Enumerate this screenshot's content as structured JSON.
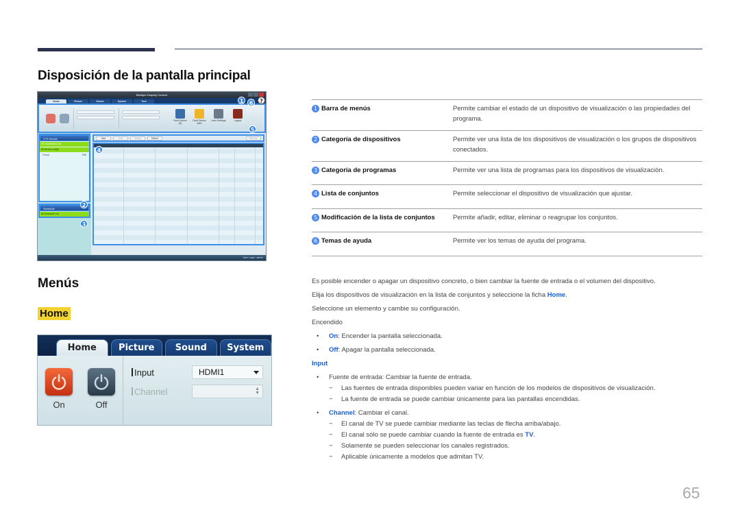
{
  "page": {
    "section_title": "Disposición de la pantalla principal",
    "menus_title": "Menús",
    "home_tag": "Home",
    "page_number": "65"
  },
  "app_screenshot": {
    "title": "Multiple Display Control",
    "tabs": [
      "Home",
      "Picture",
      "Sound",
      "System",
      "Tool"
    ],
    "ribbon": {
      "power": [
        "On",
        "Off"
      ],
      "fields": [
        "Input",
        "Channel",
        "Volume"
      ],
      "mute_label": "Mute",
      "icons": [
        {
          "label": "Fault Device (D)",
          "icon": "fault-device-icon"
        },
        {
          "label": "Fault Device Alert",
          "icon": "alert-icon"
        },
        {
          "label": "User Settings",
          "icon": "user-settings-icon"
        },
        {
          "label": "Logout",
          "icon": "logout-icon"
        }
      ]
    },
    "left_panel": {
      "device_header": "LFD Device",
      "device_rows": [
        "All Connection List",
        "All Device List(0)"
      ],
      "group_label": "Group",
      "group_edit": "Edit",
      "schedule_header": "Schedule",
      "schedule_rows": [
        "All Schedule List"
      ]
    },
    "toolbar": [
      "Add",
      "Edit",
      "Delete",
      "Detect",
      "Refresh"
    ],
    "grid_columns": [
      "Settings",
      "Connection Status",
      "MAC Address",
      "Connection Type",
      "Port",
      "SET ID Ran..",
      "Group"
    ],
    "status_bar": "User Login : admin",
    "badges": [
      "1",
      "2",
      "3",
      "4",
      "5",
      "6"
    ],
    "help_icon": "?"
  },
  "legend": [
    {
      "num": "1",
      "name": "Barra de menús",
      "desc": "Permite cambiar el estado de un dispositivo de visualización o las propiedades del programa."
    },
    {
      "num": "2",
      "name": "Categoría de dispositivos",
      "desc": "Permite ver una lista de los dispositivos de visualización o los grupos de dispositivos conectados."
    },
    {
      "num": "3",
      "name": "Categoría de programas",
      "desc": "Permite ver una lista de programas para los dispositivos de visualización."
    },
    {
      "num": "4",
      "name": "Lista de conjuntos",
      "desc": "Permite seleccionar el dispositivo de visualización que ajustar."
    },
    {
      "num": "5",
      "name": "Modificación de la lista de conjuntos",
      "desc": "Permite añadir, editar, eliminar o reagrupar los conjuntos."
    },
    {
      "num": "6",
      "name": "Temas de ayuda",
      "desc": "Permite ver los temas de ayuda del programa."
    }
  ],
  "home_menu": {
    "tabs": [
      "Home",
      "Picture",
      "Sound",
      "System"
    ],
    "on_label": "On",
    "off_label": "Off",
    "input_label": "Input",
    "input_value": "HDMI1",
    "channel_label": "Channel",
    "channel_value": ""
  },
  "body": {
    "p1": "Es posible encender o apagar un dispositivo concreto, o bien cambiar la fuente de entrada o el volumen del dispositivo.",
    "p2_pre": "Elija los dispositivos de visualización en la lista de conjuntos y seleccione la ficha ",
    "p2_link": "Home",
    "p2_post": ".",
    "p3": "Seleccione un elemento y cambie su configuración.",
    "p4": "Encendido",
    "on_term": "On",
    "on_text": ": Encender la pantalla seleccionada.",
    "off_term": "Off",
    "off_text": ": Apagar la pantalla seleccionada.",
    "input_heading": "Input",
    "input_bullet": "Fuente de entrada: Cambiar la fuente de entrada.",
    "input_notes": [
      "Las fuentes de entrada disponibles pueden variar en función de los modelos de dispositivos de visualización.",
      "La fuente de entrada se puede cambiar únicamente para las pantallas encendidas."
    ],
    "channel_term": "Channel",
    "channel_text": ": Cambiar el canal.",
    "channel_note1": "El canal de TV se puede cambiar mediante las teclas de flecha arriba/abajo.",
    "channel_note2_pre": "El canal sólo se puede cambiar cuando la fuente de entrada es ",
    "channel_note2_term": "TV",
    "channel_note2_post": ".",
    "channel_note3": "Solamente se pueden seleccionar los canales registrados.",
    "channel_note4": "Aplicable únicamente a modelos que admitan TV."
  }
}
